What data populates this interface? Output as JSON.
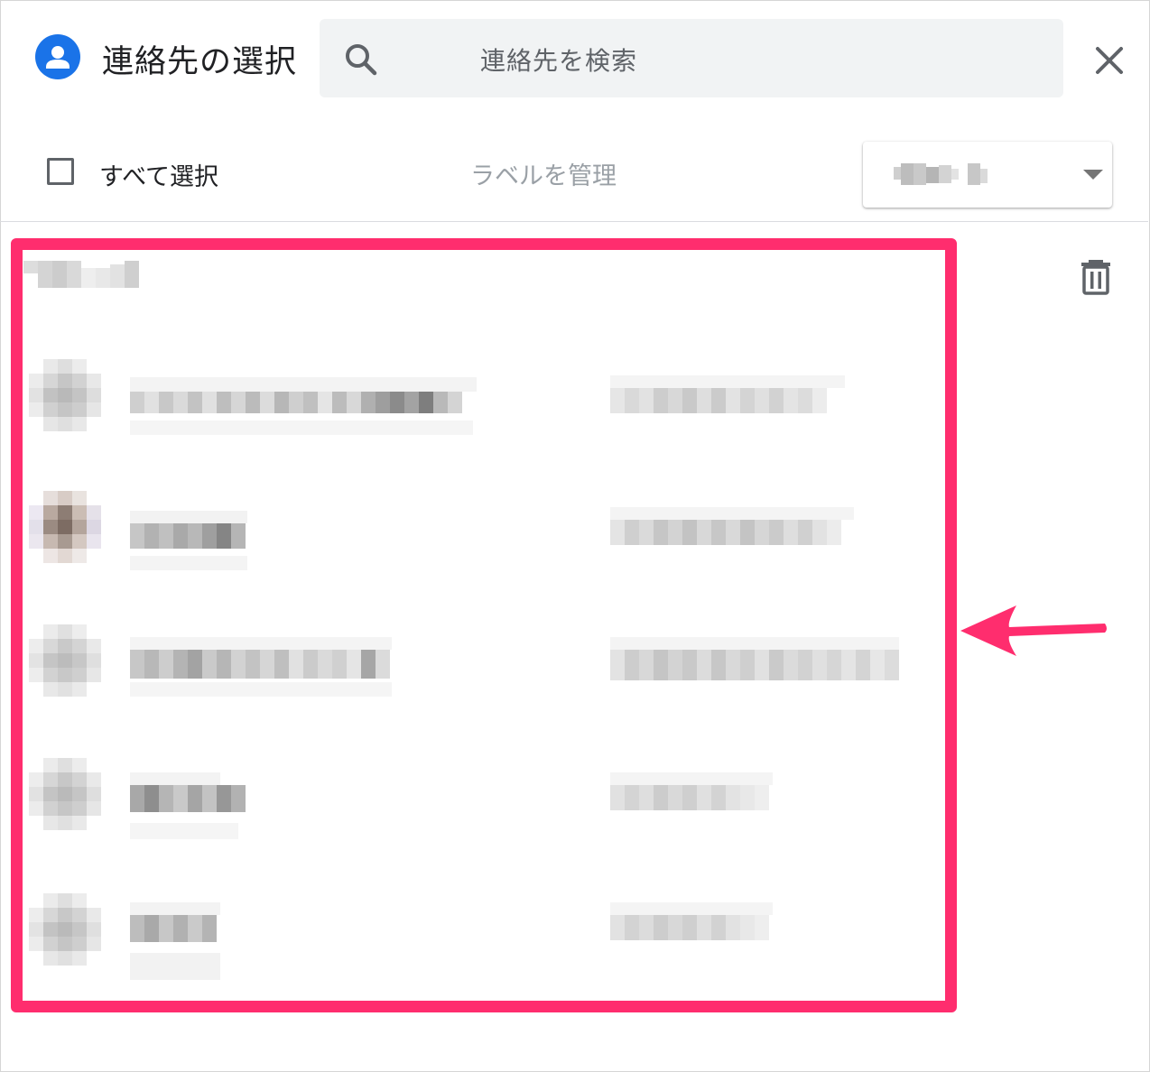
{
  "header": {
    "title": "連絡先の選択",
    "search_placeholder": "連絡先を検索"
  },
  "toolbar": {
    "select_all_label": "すべて選択",
    "manage_labels": "ラベルを管理"
  },
  "colors": {
    "accent": "#1a73e8",
    "highlight": "#ff2d6e",
    "icon_gray": "#5f6368"
  },
  "icons": {
    "app": "contacts-person-icon",
    "search": "search-icon",
    "close": "close-icon",
    "dropdown": "caret-down-icon",
    "delete": "trash-icon",
    "annotation": "arrow-left-icon"
  },
  "contacts_rows": 5
}
